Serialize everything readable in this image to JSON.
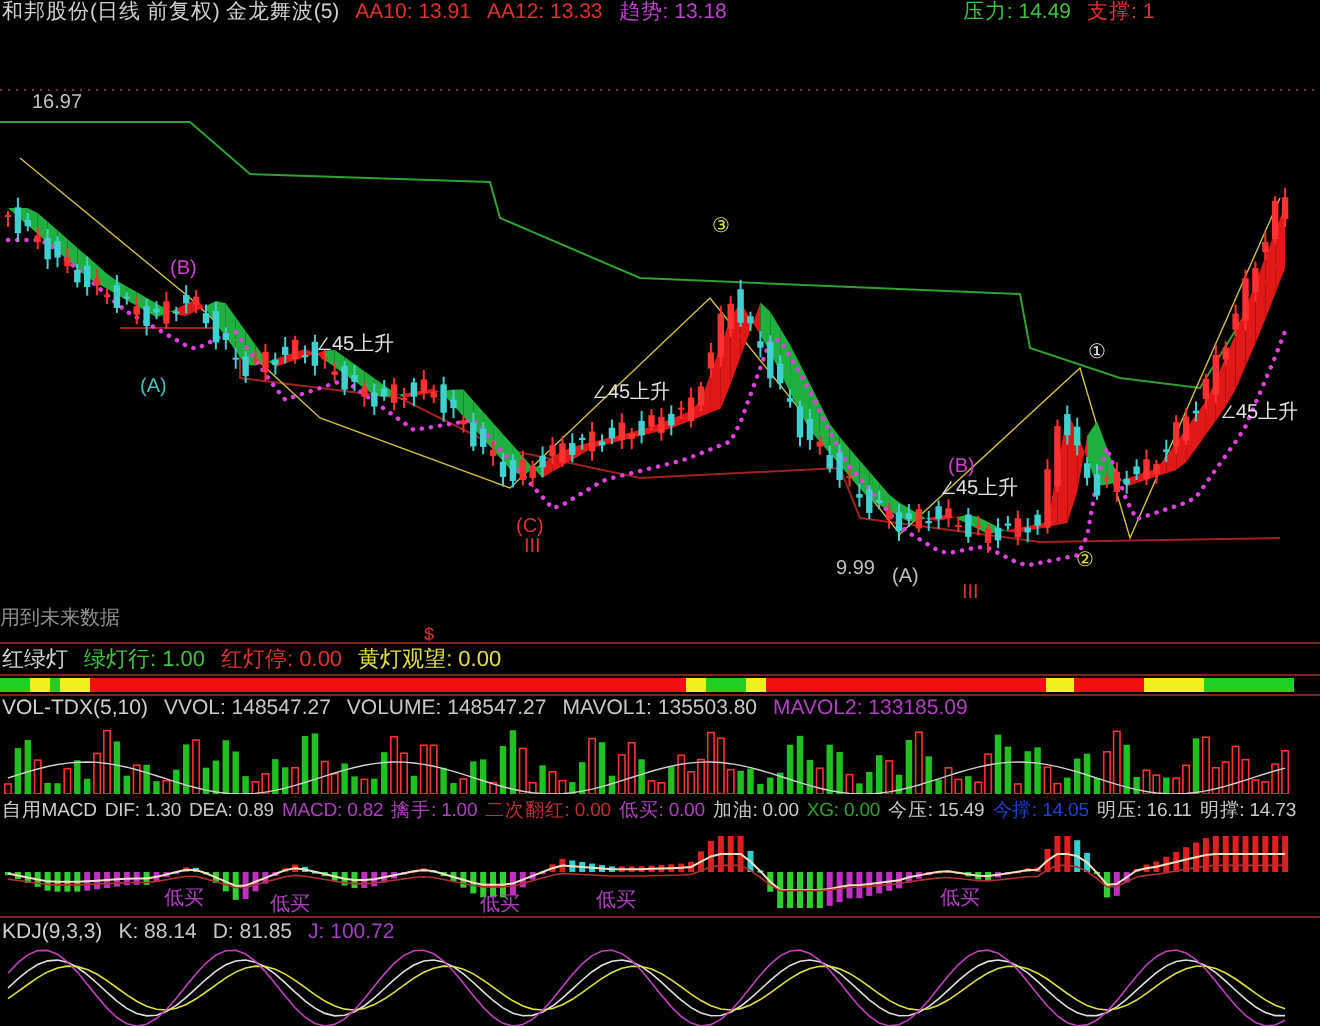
{
  "header": {
    "title": "和邦股份(日线 前复权) 金龙舞波(5)",
    "readouts": [
      {
        "text": "AA10: 13.91",
        "color": "#e03030"
      },
      {
        "text": "AA12: 13.33",
        "color": "#e03030"
      },
      {
        "text": "趋势: 13.18",
        "color": "#c040d0"
      },
      {
        "text": "压力: 14.49",
        "color": "#40c040"
      },
      {
        "text": "支撑: 1",
        "color": "#e03030"
      }
    ]
  },
  "main_chart": {
    "price_label": "16.97",
    "labels": [
      {
        "text": "(B)",
        "color": "#d040d0"
      },
      {
        "text": "(A)",
        "color": "#40c0c0"
      },
      {
        "text": "∠45上升",
        "color": "#e0e0e0"
      },
      {
        "text": "(C)",
        "color": "#e03030"
      },
      {
        "text": "III",
        "color": "#e03030"
      },
      {
        "text": "③",
        "color": "#e0e040"
      },
      {
        "text": "∠45上升",
        "color": "#e0e0e0"
      },
      {
        "text": "9.99",
        "color": "#c0c0c0"
      },
      {
        "text": "(A)",
        "color": "#c0c0c0"
      },
      {
        "text": "(B)",
        "color": "#d040d0"
      },
      {
        "text": "III",
        "color": "#e03030"
      },
      {
        "text": "①",
        "color": "#e0e0e0"
      },
      {
        "text": "∠45上升",
        "color": "#e0e0e0"
      },
      {
        "text": "②",
        "color": "#e0e040"
      },
      {
        "text": "∠45上升",
        "color": "#e0e0e0"
      }
    ],
    "note": "用到未来数据",
    "marker": "$"
  },
  "traffic_light": {
    "title": "红绿灯",
    "readouts": [
      {
        "text": "绿灯行: 1.00",
        "color": "#40c040"
      },
      {
        "text": "红灯停: 0.00",
        "color": "#e03030"
      },
      {
        "text": "黄灯观望: 0.00",
        "color": "#e0e040"
      }
    ]
  },
  "volume": {
    "title": "VOL-TDX(5,10)",
    "readouts": [
      {
        "text": "VVOL: 148547.27",
        "color": "#c8c8c8"
      },
      {
        "text": "VOLUME: 148547.27",
        "color": "#c8c8c8"
      },
      {
        "text": "MAVOL1: 135503.80",
        "color": "#c8c8c8"
      },
      {
        "text": "MAVOL2: 133185.09",
        "color": "#b040c0"
      }
    ]
  },
  "macd": {
    "title": "自用MACD",
    "readouts": [
      {
        "text": "DIF: 1.30",
        "color": "#c8c8c8"
      },
      {
        "text": "DEA: 0.89",
        "color": "#c8c8c8"
      },
      {
        "text": "MACD: 0.82",
        "color": "#b040c0"
      },
      {
        "text": "擒手: 1.00",
        "color": "#b040c0"
      },
      {
        "text": "二次翻红: 0.00",
        "color": "#c03030"
      },
      {
        "text": "低买: 0.00",
        "color": "#b040c0"
      },
      {
        "text": "加油: 0.00",
        "color": "#c8c8c8"
      },
      {
        "text": "XG: 0.00",
        "color": "#30a030"
      },
      {
        "text": "今压: 15.49",
        "color": "#c8c8c8"
      },
      {
        "text": "今撑: 14.05",
        "color": "#2040d0"
      },
      {
        "text": "明压: 16.11",
        "color": "#c8c8c8"
      },
      {
        "text": "明撑: 14.73",
        "color": "#c8c8c8"
      }
    ],
    "labels": [
      "低买",
      "低买",
      "低买",
      "低买",
      "低买"
    ]
  },
  "kdj": {
    "title": "KDJ(9,3,3)",
    "readouts": [
      {
        "text": "K: 88.14",
        "color": "#c8c8c8"
      },
      {
        "text": "D: 81.85",
        "color": "#c8c8c8"
      },
      {
        "text": "J: 100.72",
        "color": "#a040c0"
      }
    ]
  }
}
